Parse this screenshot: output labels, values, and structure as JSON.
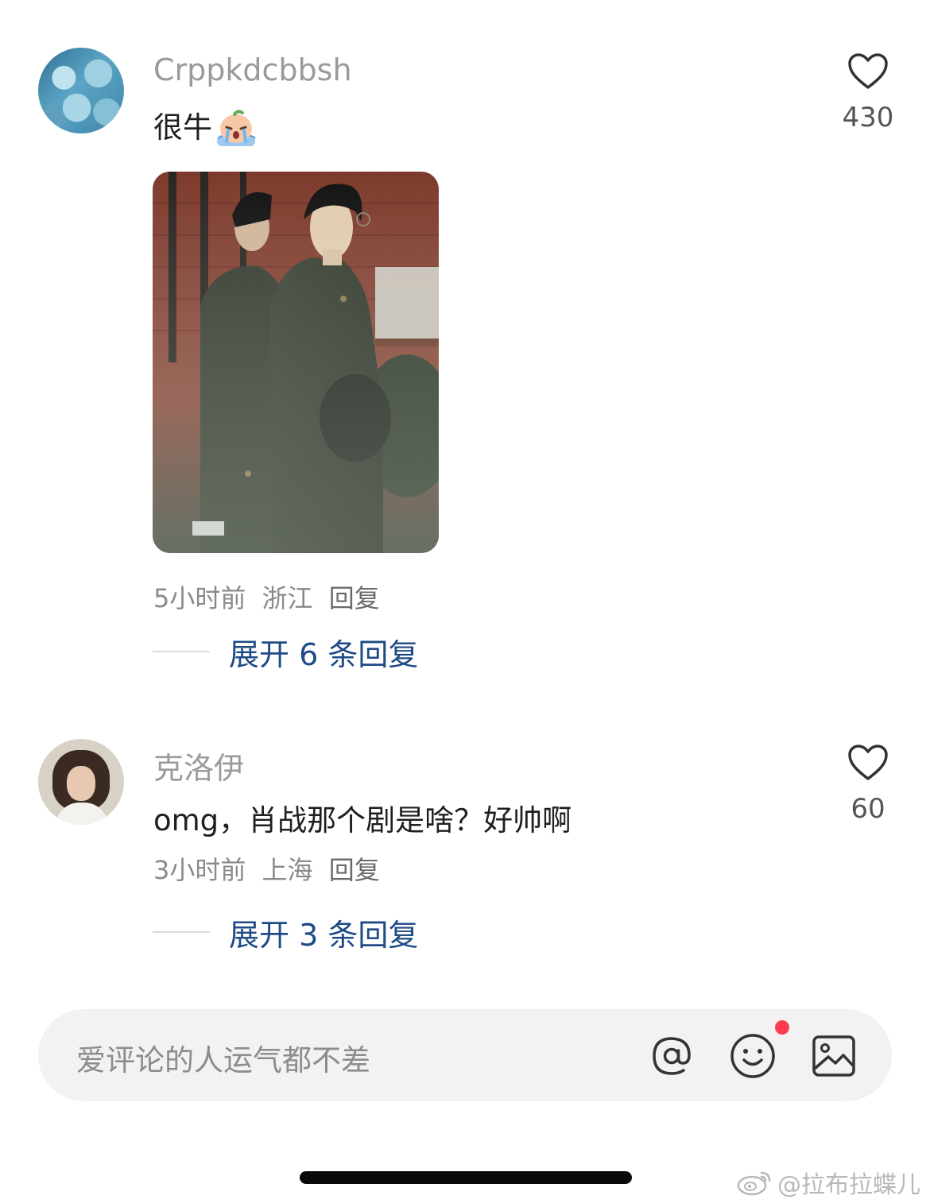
{
  "comments": [
    {
      "username": "Crppkdcbbsh",
      "text": "很牛",
      "emoji": "crying-peach-emoji",
      "likes": "430",
      "time": "5小时前",
      "location": "浙江",
      "reply_label": "回复",
      "expand_label": "展开 6 条回复",
      "has_image": true
    },
    {
      "username": "克洛伊",
      "text": "omg，肖战那个剧是啥？好帅啊",
      "likes": "60",
      "time": "3小时前",
      "location": "上海",
      "reply_label": "回复",
      "expand_label": "展开 3 条回复"
    }
  ],
  "input_bar": {
    "placeholder": "爱评论的人运气都不差",
    "icons": [
      "at-icon",
      "emoji-icon",
      "image-icon"
    ],
    "emoji_notification_color": "#ff3b4e"
  },
  "watermark": {
    "text": "@拉布拉蝶儿",
    "icon": "weibo-logo"
  },
  "colors": {
    "username": "#9a9a9a",
    "expand_link": "#1e4b86",
    "input_background": "#f2f2f2"
  }
}
